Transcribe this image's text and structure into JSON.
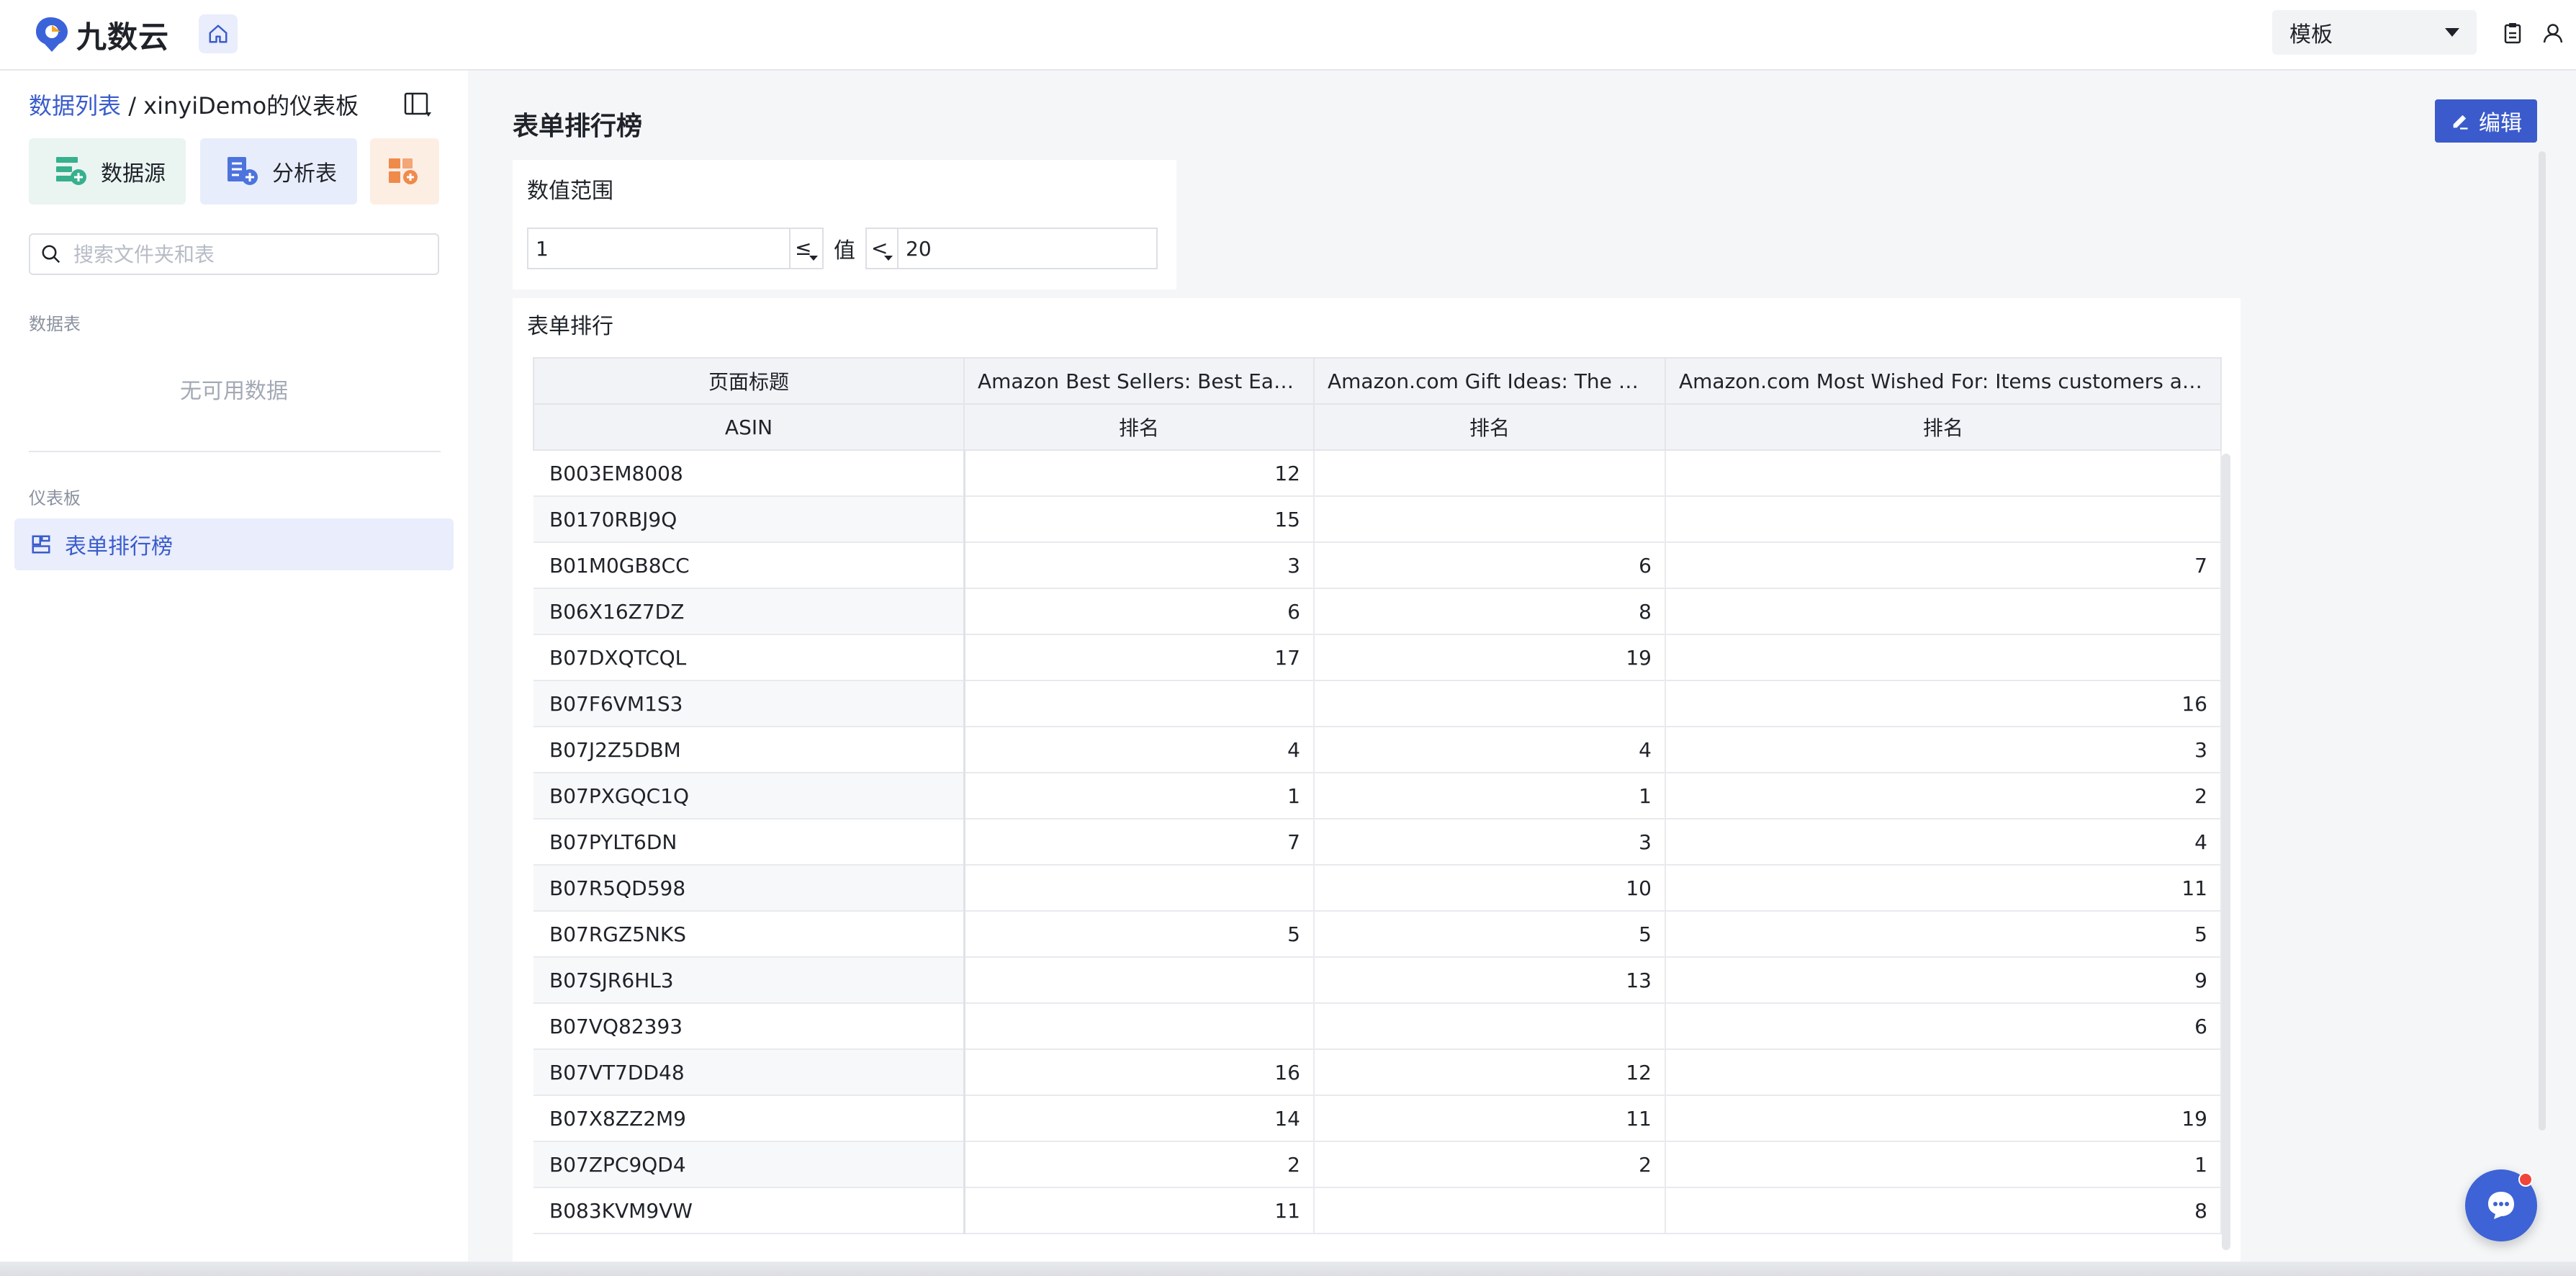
{
  "app": {
    "logo_text": "九数云"
  },
  "header": {
    "template_select": "模板"
  },
  "sidebar": {
    "breadcrumb_link": "数据列表",
    "breadcrumb_sep": " / ",
    "breadcrumb_current": "xinyiDemo的仪表板",
    "buttons": {
      "datasource": "数据源",
      "analysis": "分析表"
    },
    "search_placeholder": "搜索文件夹和表",
    "section_tables": "数据表",
    "empty_text": "无可用数据",
    "section_dashboards": "仪表板",
    "active_item": "表单排行榜"
  },
  "main": {
    "title": "表单排行榜",
    "edit_label": "编辑",
    "filter": {
      "title": "数值范围",
      "min_value": "1",
      "op1": "≤",
      "value_label": "值",
      "op2": "<",
      "max_value": "20"
    },
    "table": {
      "title": "表单排行",
      "header_row1": [
        "页面标题",
        "Amazon Best Sellers: Best Earbud & In-Ear Headphones",
        "Amazon.com Gift Ideas: The most popular",
        "Amazon.com Most Wished For: Items customers add to Wish Lists"
      ],
      "header_row1_display": [
        "页面标题",
        "Amazon Best Sellers: Best Earb...",
        "Amazon.com Gift Ideas: The mo...",
        "Amazon.com Most Wished For: Items customers add..."
      ],
      "header_row2": [
        "ASIN",
        "排名",
        "排名",
        "排名"
      ],
      "rows": [
        [
          "B003EM8008",
          "12",
          "",
          ""
        ],
        [
          "B0170RBJ9Q",
          "15",
          "",
          ""
        ],
        [
          "B01M0GB8CC",
          "3",
          "6",
          "7"
        ],
        [
          "B06X16Z7DZ",
          "6",
          "8",
          ""
        ],
        [
          "B07DXQTCQL",
          "17",
          "19",
          ""
        ],
        [
          "B07F6VM1S3",
          "",
          "",
          "16"
        ],
        [
          "B07J2Z5DBM",
          "4",
          "4",
          "3"
        ],
        [
          "B07PXGQC1Q",
          "1",
          "1",
          "2"
        ],
        [
          "B07PYLT6DN",
          "7",
          "3",
          "4"
        ],
        [
          "B07R5QD598",
          "",
          "10",
          "11"
        ],
        [
          "B07RGZ5NKS",
          "5",
          "5",
          "5"
        ],
        [
          "B07SJR6HL3",
          "",
          "13",
          "9"
        ],
        [
          "B07VQ82393",
          "",
          "",
          "6"
        ],
        [
          "B07VT7DD48",
          "16",
          "12",
          ""
        ],
        [
          "B07X8ZZ2M9",
          "14",
          "11",
          "19"
        ],
        [
          "B07ZPC9QD4",
          "2",
          "2",
          "1"
        ],
        [
          "B083KVM9VW",
          "11",
          "",
          "8"
        ]
      ]
    }
  },
  "colors": {
    "primary": "#3b5bcc",
    "active_bg": "#e9edfc",
    "datasource_bg": "#eaf4f1",
    "analysis_bg": "#e8edfb",
    "more_bg": "#fdeee4"
  }
}
